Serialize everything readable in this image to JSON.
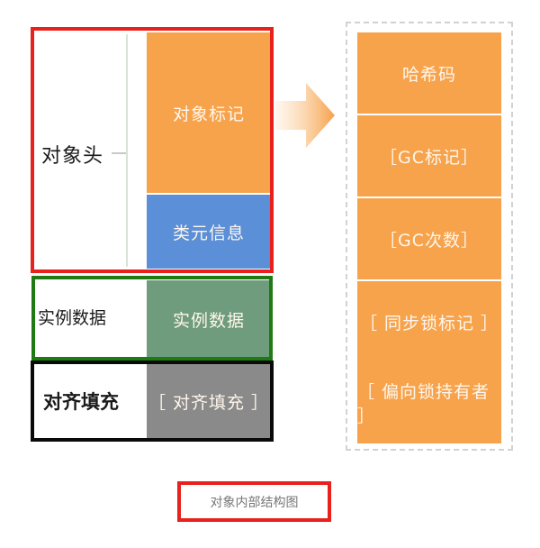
{
  "left": {
    "header_label": "对象头",
    "mark_word": "对象标记",
    "class_meta": "类元信息",
    "instance_label": "实例数据",
    "instance_fill": "实例数据",
    "padding_label": "对齐填充",
    "padding_fill": "［ 对齐填充 ］"
  },
  "right": {
    "items": [
      "哈希码",
      "［GC标记］",
      "［GC次数］",
      "［ 同步锁标记 ］",
      "［ 偏向锁持有者 ］"
    ]
  },
  "caption": "对象内部结构图",
  "colors": {
    "header_border": "#e8211c",
    "instance_border": "#1f7a14",
    "padding_border": "#0a0a0a",
    "orange": "#f7a34c",
    "blue": "#5b8fd8",
    "green": "#6f9c7c",
    "gray": "#8a8a8a"
  }
}
